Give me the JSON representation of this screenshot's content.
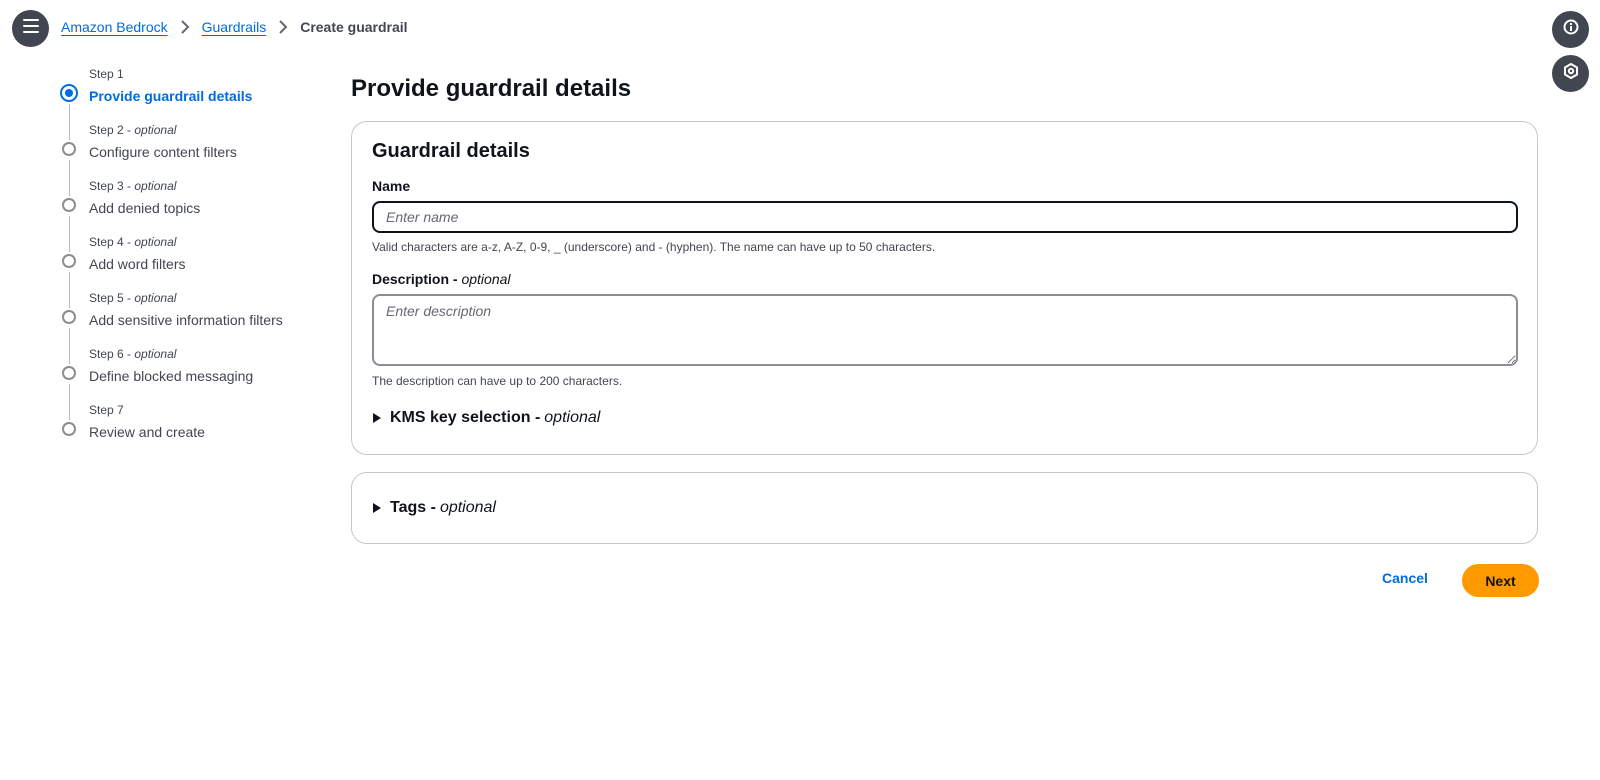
{
  "icons": {
    "menu": "menu-icon",
    "info": "info-icon",
    "aside": "hexagon-icon",
    "breadcrumb_separator": "chevron-right-icon",
    "expand": "caret-right-icon"
  },
  "colors": {
    "link": "#006ce0",
    "primary_button": "#ff9900",
    "icon_button_bg": "#424650",
    "text": "#0f141a",
    "muted_text": "#424650",
    "border": "#c6c6cd"
  },
  "breadcrumb": {
    "items": [
      "Amazon Bedrock",
      "Guardrails"
    ],
    "current": "Create guardrail"
  },
  "steps": [
    {
      "num": "Step 1",
      "optional": "",
      "title": "Provide guardrail details",
      "active": true
    },
    {
      "num": "Step 2",
      "optional": "optional",
      "title": "Configure content filters",
      "active": false
    },
    {
      "num": "Step 3",
      "optional": "optional",
      "title": "Add denied topics",
      "active": false
    },
    {
      "num": "Step 4",
      "optional": "optional",
      "title": "Add word filters",
      "active": false
    },
    {
      "num": "Step 5",
      "optional": "optional",
      "title": "Add sensitive information filters",
      "active": false
    },
    {
      "num": "Step 6",
      "optional": "optional",
      "title": "Define blocked messaging",
      "active": false
    },
    {
      "num": "Step 7",
      "optional": "",
      "title": "Review and create",
      "active": false
    }
  ],
  "page_title": "Provide guardrail details",
  "details": {
    "header": "Guardrail details",
    "name_label": "Name",
    "name_placeholder": "Enter name",
    "name_value": "",
    "name_hint": "Valid characters are a-z, A-Z, 0-9, _ (underscore) and - (hyphen). The name can have up to 50 characters.",
    "description_label": "Description - ",
    "description_optional": "optional",
    "description_placeholder": "Enter description",
    "description_value": "",
    "description_hint": "The description can have up to 200 characters.",
    "kms_label": "KMS key selection - ",
    "kms_optional": "optional"
  },
  "tags": {
    "label": "Tags - ",
    "optional": "optional"
  },
  "actions": {
    "cancel": "Cancel",
    "next": "Next"
  }
}
